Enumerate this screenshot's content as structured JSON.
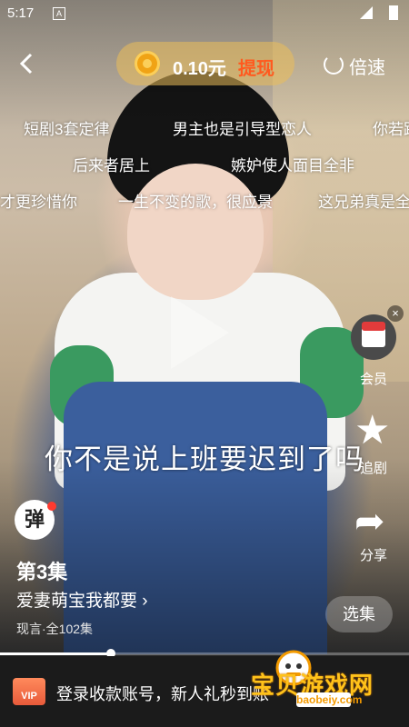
{
  "status_bar": {
    "time": "5:17",
    "notification_icon": "A"
  },
  "header": {
    "back_icon": "chevron-left-icon",
    "coin_amount": "0.10元",
    "withdraw_label": "提现",
    "speed_label": "倍速"
  },
  "danmaku": [
    "短剧3套定律",
    "男主也是引导型恋人",
    "你若跟",
    "后来者居上",
    "嫉妒使人面目全非",
    "才更珍惜你",
    "一生不变的歌，很应景",
    "这兄弟真是全"
  ],
  "subtitle": "你不是说上班要迟到了吗",
  "side_actions": {
    "vip_label": "会员",
    "follow_label": "追剧",
    "share_label": "分享",
    "close_symbol": "×"
  },
  "drama": {
    "avatar_char": "弹",
    "episode": "第3集",
    "title": "爱妻萌宝我都要 ›",
    "meta": "现言·全102集",
    "collection_button": "选集"
  },
  "progress": {
    "played_fraction": 0.27
  },
  "banner": {
    "vip_tag": "VIP",
    "text": "登录收款账号，新人礼秒到账",
    "cta": "秒到账"
  },
  "watermark": {
    "title": "宝贝游戏网",
    "url": "baobeiy.com"
  },
  "colors": {
    "withdraw": "#ff5a1f",
    "coin": "#f0a315",
    "watermark": "#ffc21a"
  }
}
